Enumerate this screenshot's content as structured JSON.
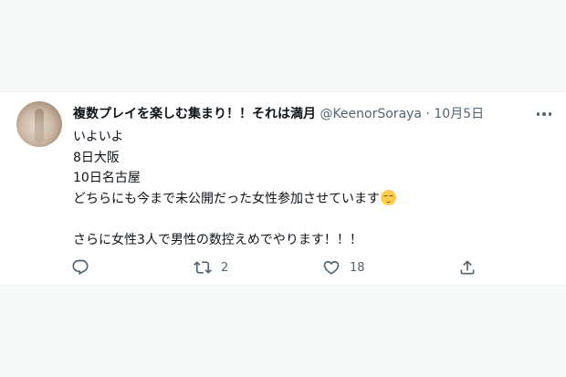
{
  "tweet": {
    "author_name": "複数プレイを楽しむ集まり！！それは満月",
    "handle": "@KeenorSoraya",
    "separator": "·",
    "date": "10月5日",
    "lines": [
      "いよいよ",
      "8日大阪",
      "10日名古屋",
      "どちらにも今まで未公開だった女性参加させています",
      "",
      "さらに女性3人で男性の数控えめでやります！！！"
    ],
    "emoji": "relieved-face",
    "actions": {
      "reply_count": "",
      "retweet_count": "2",
      "like_count": "18",
      "share_count": ""
    }
  },
  "colors": {
    "text": "#0f1419",
    "secondary": "#536471",
    "background": "#f7f9f9",
    "card": "#ffffff"
  }
}
